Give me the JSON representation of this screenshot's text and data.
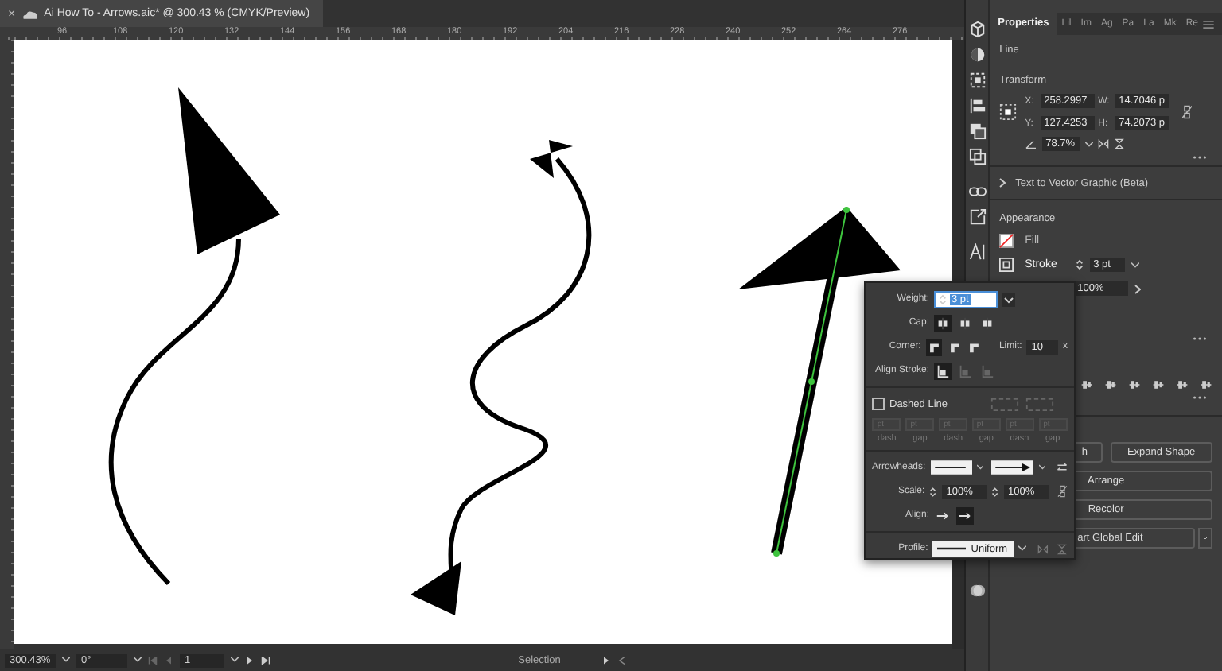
{
  "document_tab": {
    "title": "Ai How To - Arrows.aic* @ 300.43 % (CMYK/Preview)",
    "close": "×"
  },
  "ruler": {
    "ticks": [
      "96",
      "108",
      "120",
      "132",
      "144",
      "156",
      "168",
      "180",
      "192",
      "204",
      "216",
      "228",
      "240",
      "252",
      "264",
      "276"
    ]
  },
  "properties_panel": {
    "tabs": [
      {
        "label": "Properties",
        "selected": true
      },
      {
        "label": "Lil",
        "selected": false
      },
      {
        "label": "Im",
        "selected": false
      },
      {
        "label": "Ag",
        "selected": false
      },
      {
        "label": "Pa",
        "selected": false
      },
      {
        "label": "La",
        "selected": false
      },
      {
        "label": "Mk",
        "selected": false
      },
      {
        "label": "Re",
        "selected": false
      }
    ],
    "object_type": "Line",
    "transform": {
      "title": "Transform",
      "fields": [
        {
          "label": "X:",
          "value": "258.2997"
        },
        {
          "label": "W:",
          "value": "14.7046 p"
        },
        {
          "label": "Y:",
          "value": "127.4253"
        },
        {
          "label": "H:",
          "value": "74.2073 p"
        }
      ],
      "angle": "78.7%"
    },
    "text_to_vector": "Text to Vector Graphic (Beta)",
    "appearance": {
      "title": "Appearance",
      "fill_label": "Fill",
      "stroke_label": "Stroke",
      "stroke_weight": "3 pt",
      "opacity": "100%"
    },
    "buttons": [
      {
        "label": "h",
        "kind": "half"
      },
      {
        "label": "Expand Shape",
        "kind": "half"
      },
      {
        "label": "Arrange",
        "kind": "full"
      },
      {
        "label": "Recolor",
        "kind": "full"
      }
    ],
    "global_edit": "art Global Edit"
  },
  "stroke_popup": {
    "weight_label": "Weight:",
    "weight": "3 pt",
    "cap_label": "Cap:",
    "cap_options": [
      {
        "selected": true
      },
      {
        "selected": false
      },
      {
        "selected": false
      }
    ],
    "corner_label": "Corner:",
    "corner_options": [
      {
        "selected": true
      },
      {
        "selected": false
      },
      {
        "selected": false
      }
    ],
    "limit_label": "Limit:",
    "limit": "10",
    "limit_unit": "x",
    "align_stroke_label": "Align Stroke:",
    "align_stroke_options": [
      {
        "selected": true,
        "disabled": false
      },
      {
        "selected": false,
        "disabled": true
      },
      {
        "selected": false,
        "disabled": true
      }
    ],
    "dashed_line": {
      "label": "Dashed Line",
      "checked": false
    },
    "dash_fields": [
      {
        "label": "dash",
        "placeholder": "pt"
      },
      {
        "label": "gap",
        "placeholder": "pt"
      },
      {
        "label": "dash",
        "placeholder": "pt"
      },
      {
        "label": "gap",
        "placeholder": "pt"
      },
      {
        "label": "dash",
        "placeholder": "pt"
      },
      {
        "label": "gap",
        "placeholder": "pt"
      }
    ],
    "arrowheads_label": "Arrowheads:",
    "arrowheads": [
      {
        "kind": "none"
      },
      {
        "kind": "arrow"
      }
    ],
    "scale_label": "Scale:",
    "scale_start": "100%",
    "scale_end": "100%",
    "align_label": "Align:",
    "align_options": [
      {
        "selected": false
      },
      {
        "selected": true
      }
    ],
    "profile_label": "Profile:",
    "profile": "Uniform"
  },
  "status_bar": {
    "zoom": "300.43%",
    "rotation": "0°",
    "artboard": "1",
    "tool": "Selection"
  }
}
